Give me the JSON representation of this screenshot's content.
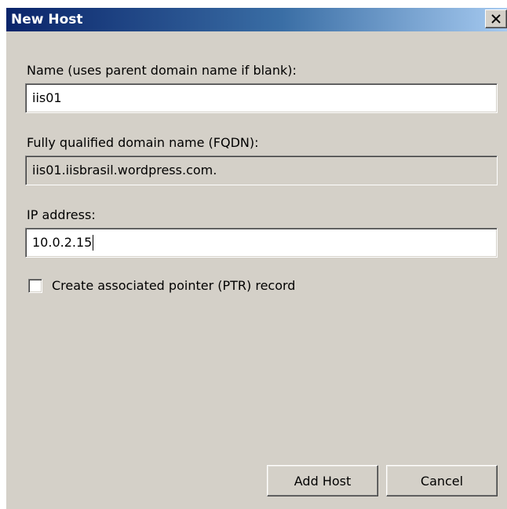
{
  "window": {
    "title": "New Host",
    "close_icon": "close-icon"
  },
  "form": {
    "name_label": "Name (uses parent domain name if blank):",
    "name_value": "iis01",
    "fqdn_label": "Fully qualified domain name (FQDN):",
    "fqdn_value": "iis01.iisbrasil.wordpress.com.",
    "ip_label": "IP address:",
    "ip_value": "10.0.2.15",
    "ptr_label": "Create associated pointer (PTR) record",
    "ptr_checked": false
  },
  "buttons": {
    "add_host": "Add Host",
    "cancel": "Cancel"
  },
  "colors": {
    "dialog_bg": "#d4d0c8",
    "title_gradient_start": "#0a246a",
    "title_gradient_end": "#a6caf0"
  }
}
